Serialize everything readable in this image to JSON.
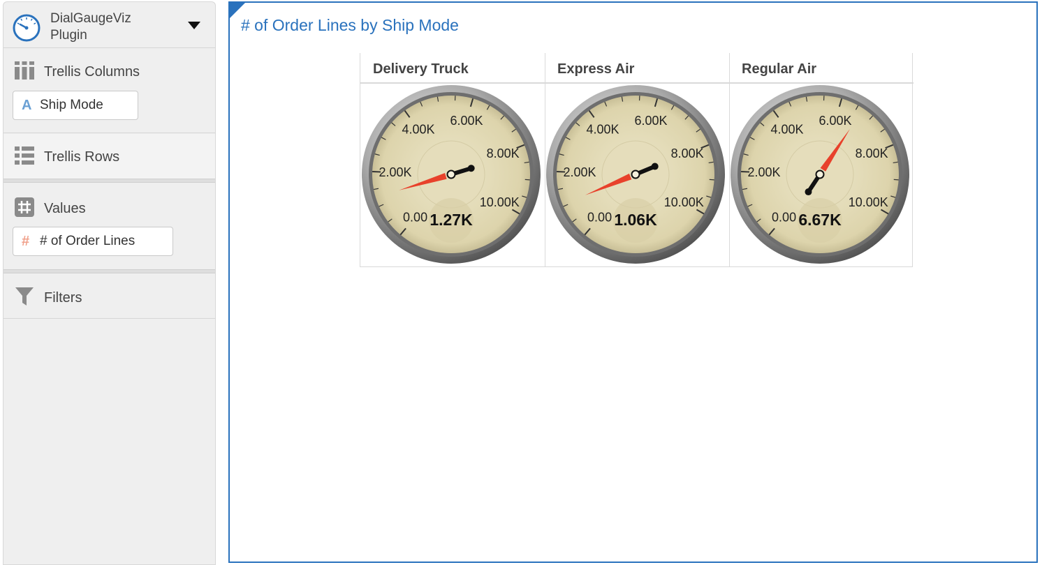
{
  "sidebar": {
    "plugin_name": "DialGaugeViz Plugin",
    "sections": {
      "trellis_columns": {
        "title": "Trellis Columns",
        "pill": "Ship Mode",
        "pill_icon": "A"
      },
      "trellis_rows": {
        "title": "Trellis Rows"
      },
      "values": {
        "title": "Values",
        "pill": "# of Order Lines",
        "pill_icon": "#"
      },
      "filters": {
        "title": "Filters"
      }
    }
  },
  "viz": {
    "title": "# of Order Lines by Ship Mode",
    "accent_color": "#2a72bd"
  },
  "chart_data": {
    "type": "gauge",
    "title": "# of Order Lines by Ship Mode",
    "categories": [
      "Delivery Truck",
      "Express Air",
      "Regular Air"
    ],
    "values": [
      1270,
      1060,
      6670
    ],
    "value_labels": [
      "1.27K",
      "1.06K",
      "6.67K"
    ],
    "range": [
      0,
      10000
    ],
    "tick_labels": [
      "0.00",
      "2.00K",
      "4.00K",
      "6.00K",
      "8.00K",
      "10.00K"
    ],
    "tick_values": [
      0,
      2000,
      4000,
      6000,
      8000,
      10000
    ],
    "needle_colors": {
      "tip": "#e8412b",
      "tail": "#111111"
    }
  }
}
